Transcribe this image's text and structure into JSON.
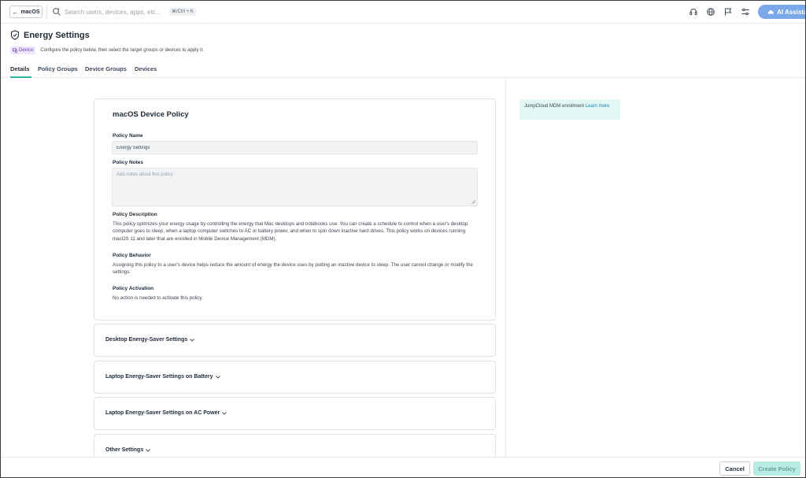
{
  "topbar": {
    "back_label": "macOS",
    "search_placeholder": "Search users, devices, apps, etc...",
    "shortcut": "⌘/Ctrl + K",
    "ai_label": "AI Assistant"
  },
  "header": {
    "title": "Energy Settings",
    "badge": "Device",
    "subtitle": "Configure the policy below, then select the target groups or devices to apply it."
  },
  "tabs": [
    {
      "label": "Details",
      "active": true
    },
    {
      "label": "Policy Groups",
      "active": false
    },
    {
      "label": "Device Groups",
      "active": false
    },
    {
      "label": "Devices",
      "active": false
    }
  ],
  "policy": {
    "card_title": "macOS Device Policy",
    "name_label": "Policy Name",
    "name_value": "Energy Settings",
    "notes_label": "Policy Notes",
    "notes_placeholder": "Add notes about this policy",
    "description_label": "Policy Description",
    "description_text": "This policy optimizes your energy usage by controlling the energy that Mac desktops and notebooks use. You can create a schedule to control when a user's desktop computer goes to sleep, when a laptop computer switches to AC or battery power, and when to spin down inactive hard drives. This policy works on devices running macOS 11 and later that are enrolled in Mobile Device Management (MDM).",
    "behavior_label": "Policy Behavior",
    "behavior_text": "Assigning this policy to a user's device helps reduce the amount of energy the device uses by putting an inactive device to sleep. The user cannot change or modify the settings.",
    "activation_label": "Policy Activation",
    "activation_text": "No action is needed to activate this policy."
  },
  "sections": [
    {
      "label": "Desktop Energy-Saver Settings"
    },
    {
      "label": "Laptop Energy-Saver Settings on Battery"
    },
    {
      "label": "Laptop Energy-Saver Settings on AC Power"
    },
    {
      "label": "Other Settings"
    }
  ],
  "info": {
    "text": "JumpCloud MDM enrollment",
    "link": "Learn more"
  },
  "footer": {
    "cancel_label": "Cancel",
    "create_label": "Create Policy"
  },
  "colors": {
    "accent": "#2bb3a6",
    "ai_button": "#7aa8e8",
    "info_bg": "#e3f7f4",
    "create_disabled": "#b7ebe4",
    "badge_bg": "#ede6fb"
  }
}
